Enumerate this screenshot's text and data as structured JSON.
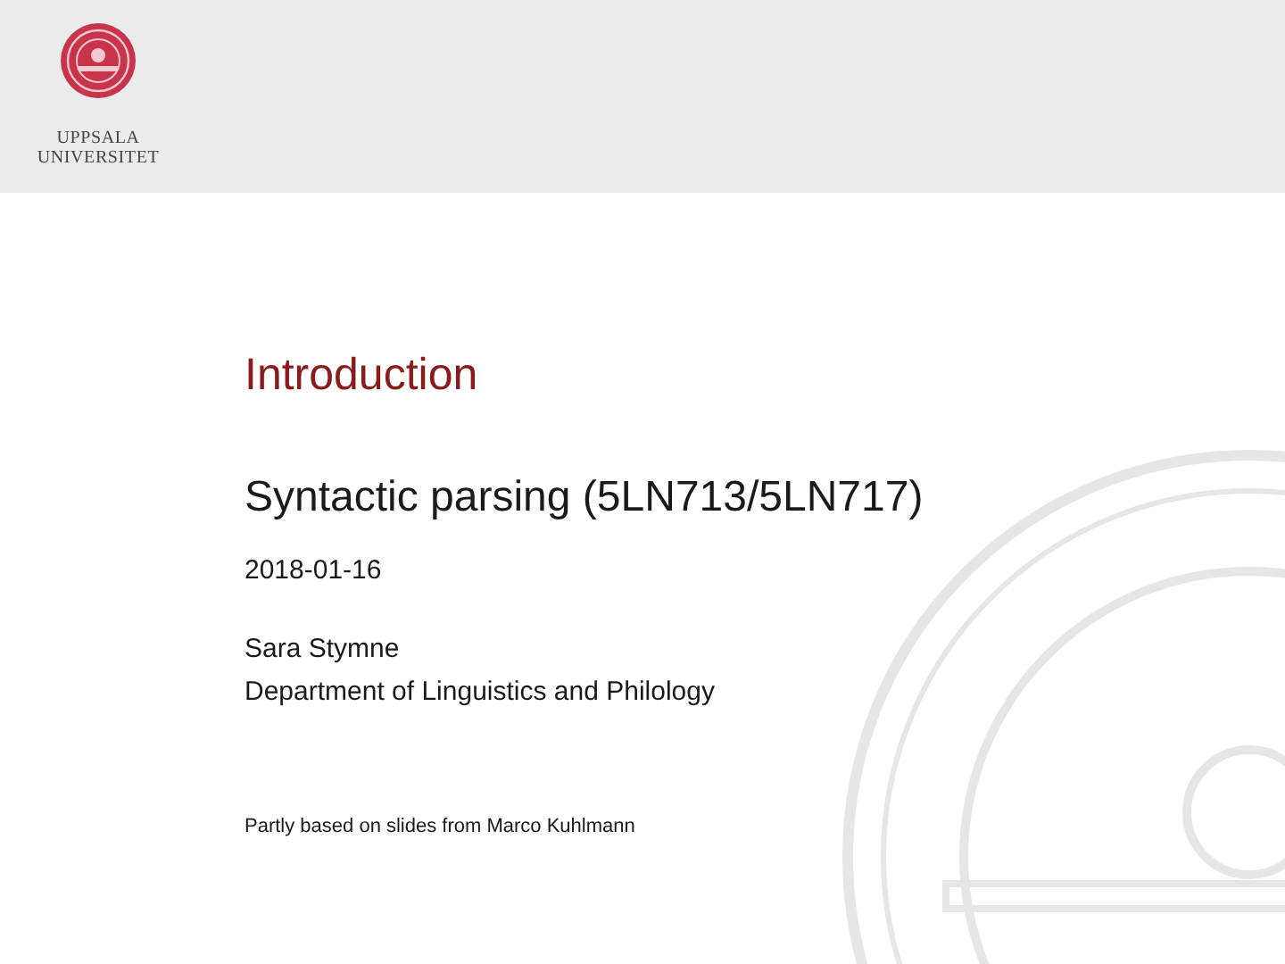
{
  "header": {
    "logo_lines": [
      "UPPSALA",
      "UNIVERSITET"
    ]
  },
  "slide": {
    "title": "Introduction",
    "subtitle": "Syntactic parsing (5LN713/5LN717)",
    "date": "2018-01-16",
    "author": "Sara Stymne",
    "department": "Department of Linguistics and Philology",
    "note": "Partly based on slides from Marco Kuhlmann"
  }
}
